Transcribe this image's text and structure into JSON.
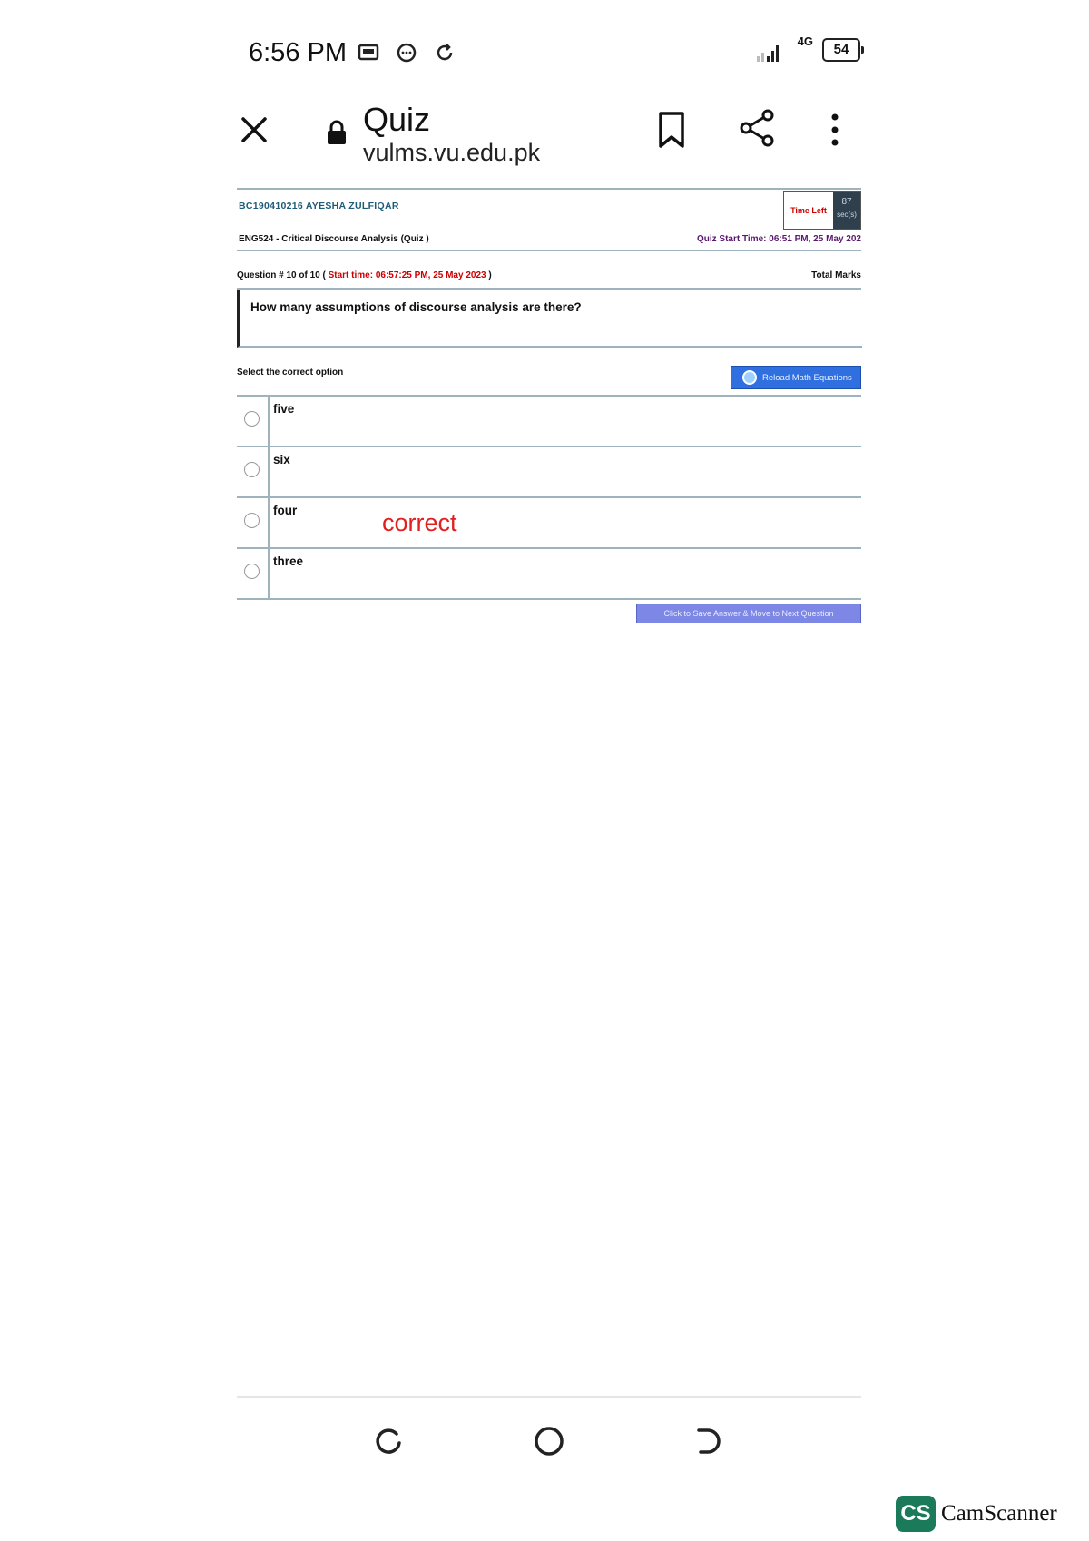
{
  "status_bar": {
    "time": "6:56 PM",
    "network": "4G",
    "battery": "54"
  },
  "browser": {
    "title": "Quiz",
    "url": "vulms.vu.edu.pk"
  },
  "quiz": {
    "student": "BC190410216  AYESHA ZULFIQAR",
    "time_left_label": "Time Left",
    "time_left_value": "87",
    "time_left_unit": "sec(s)",
    "course": "ENG524 - Critical Discourse Analysis (Quiz )",
    "quiz_start_time": "Quiz Start Time: 06:51 PM, 25 May 202",
    "question_number": "Question # 10 of 10 (",
    "question_start": "Start time: 06:57:25 PM, 25 May 2023",
    "question_number_close": ")",
    "total_marks": "Total Marks",
    "question": "How many assumptions of discourse analysis are there?",
    "select_label": "Select the correct option",
    "reload_label": "Reload Math Equations",
    "options": [
      {
        "label": "five"
      },
      {
        "label": "six"
      },
      {
        "label": "four"
      },
      {
        "label": "three"
      }
    ],
    "correct_note": "correct",
    "save_label": "Click to Save Answer & Move to Next Question"
  },
  "watermark": {
    "badge": "CS",
    "text": "CamScanner"
  }
}
